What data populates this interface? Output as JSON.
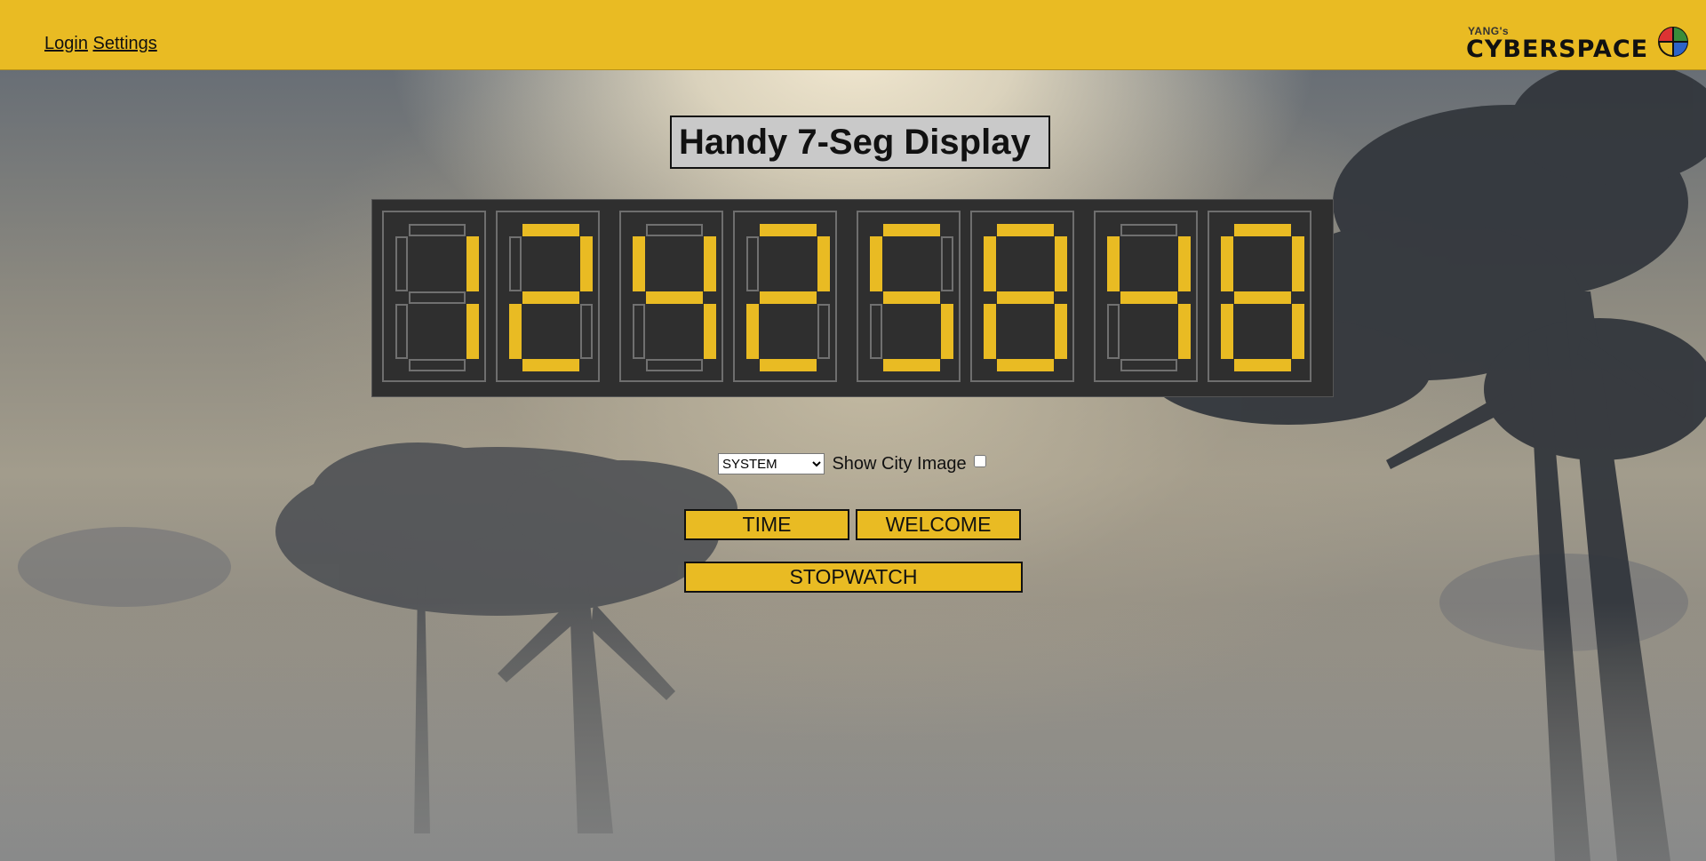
{
  "nav": {
    "login": "Login",
    "settings": "Settings"
  },
  "logo": {
    "small": "YANG's",
    "big": "CYBERSPACE",
    "icon": "globe-icon"
  },
  "title": "Handy 7-Seg Display",
  "display": {
    "on_color": "#e9bb23",
    "off_color": "#707070",
    "digits": [
      {
        "segments": [
          "b",
          "c"
        ]
      },
      {
        "segments": [
          "a",
          "b",
          "g",
          "e",
          "d"
        ]
      },
      {
        "segments": [
          "f",
          "g",
          "b",
          "c"
        ]
      },
      {
        "segments": [
          "a",
          "b",
          "g",
          "e",
          "d"
        ]
      },
      {
        "segments": [
          "a",
          "f",
          "g",
          "c",
          "d"
        ]
      },
      {
        "segments": [
          "a",
          "b",
          "c",
          "d",
          "e",
          "f",
          "g"
        ]
      },
      {
        "segments": [
          "f",
          "g",
          "b",
          "c"
        ]
      },
      {
        "segments": [
          "a",
          "b",
          "c",
          "d",
          "e",
          "f",
          "g"
        ]
      }
    ]
  },
  "controls": {
    "source_select": {
      "selected": "SYSTEM",
      "options": [
        "SYSTEM"
      ]
    },
    "show_city_label": "Show City Image",
    "show_city_checked": false
  },
  "buttons": {
    "time": "TIME",
    "welcome": "WELCOME",
    "stopwatch": "STOPWATCH"
  },
  "colors": {
    "accent": "#e9bb23",
    "panel": "#2f2f2f"
  }
}
